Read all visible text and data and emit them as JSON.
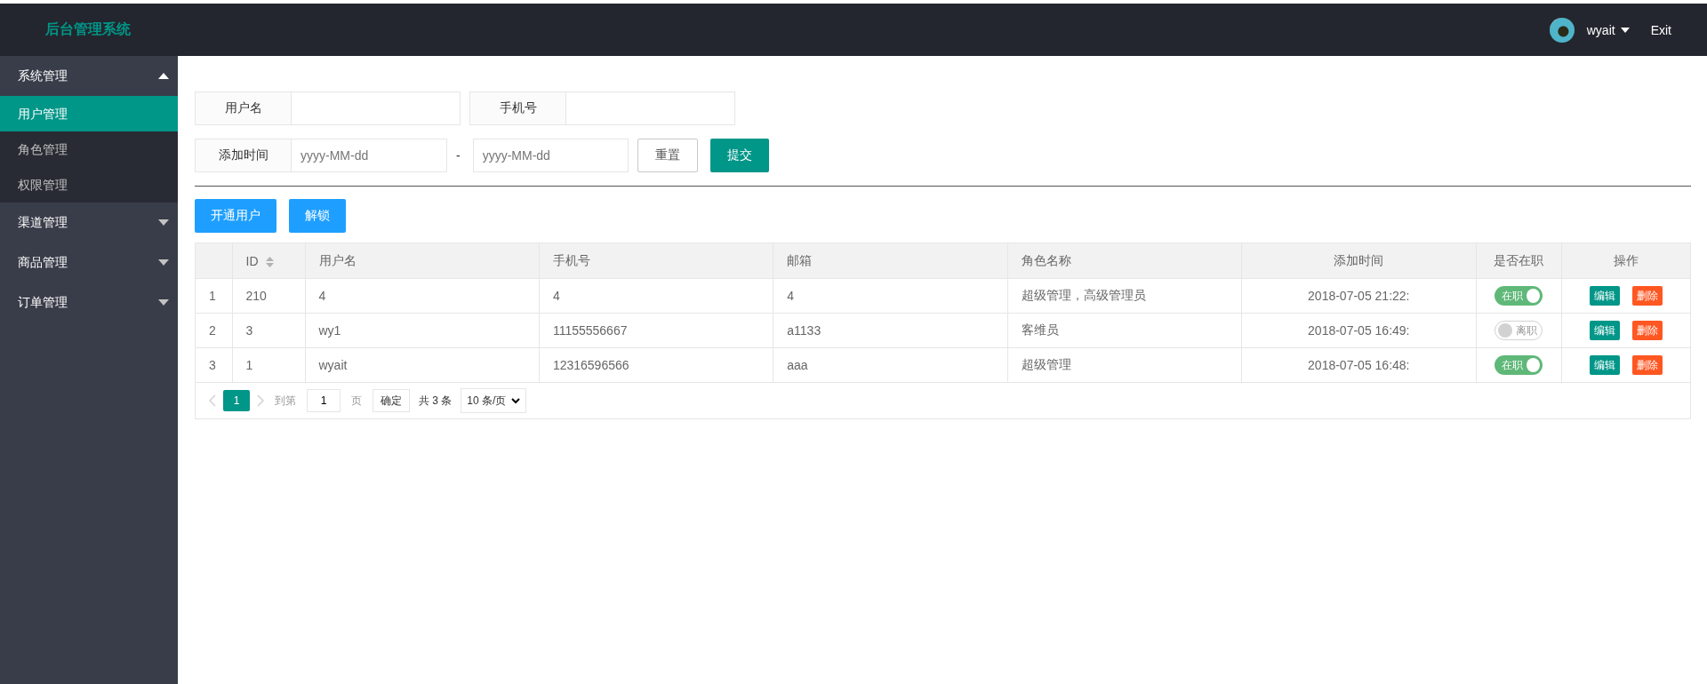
{
  "header": {
    "logo": "后台管理系统",
    "user": "wyait",
    "exit": "Exit"
  },
  "sidebar": {
    "groups": [
      {
        "label": "系统管理",
        "expanded": true,
        "children": [
          {
            "label": "用户管理",
            "selected": true
          },
          {
            "label": "角色管理",
            "selected": false
          },
          {
            "label": "权限管理",
            "selected": false
          }
        ]
      },
      {
        "label": "渠道管理",
        "expanded": false
      },
      {
        "label": "商品管理",
        "expanded": false
      },
      {
        "label": "订单管理",
        "expanded": false
      }
    ]
  },
  "search": {
    "rows": [
      {
        "fields": [
          {
            "label": "用户名"
          },
          {
            "label": "手机号"
          }
        ]
      },
      {
        "fields": [
          {
            "label": "添加时间",
            "placeholder": "yyyy-MM-dd"
          },
          {
            "separator": "-",
            "placeholder": "yyyy-MM-dd"
          }
        ],
        "buttons": [
          {
            "label": "重置",
            "kind": "plain"
          },
          {
            "label": "提交",
            "kind": "primary"
          }
        ]
      }
    ]
  },
  "toolbar": {
    "buttons": [
      "开通用户",
      "解锁"
    ]
  },
  "table": {
    "columns": [
      {},
      {
        "label": "ID",
        "sortable": true
      },
      {
        "label": "用户名"
      },
      {
        "label": "手机号"
      },
      {
        "label": "邮箱"
      },
      {
        "label": "角色名称"
      },
      {
        "label": "添加时间"
      },
      {
        "label": "是否在职"
      },
      {
        "label": "操作"
      }
    ],
    "rows": [
      {
        "index": "1",
        "id": "210",
        "username": "4",
        "phone": "4",
        "email": "4",
        "roles": "超级管理，高级管理员",
        "added": "2018-07-05 21:22:",
        "on": true,
        "switch_text": "在职",
        "actions": [
          "编辑",
          "删除"
        ]
      },
      {
        "index": "2",
        "id": "3",
        "username": "wy1",
        "phone": "11155556667",
        "email": "a1133",
        "roles": "客维员",
        "added": "2018-07-05 16:49:",
        "on": false,
        "switch_text": "离职",
        "actions": [
          "编辑",
          "删除"
        ]
      },
      {
        "index": "3",
        "id": "1",
        "username": "wyait",
        "phone": "12316596566",
        "email": "aaa",
        "roles": "超级管理",
        "added": "2018-07-05 16:48:",
        "on": true,
        "switch_text": "在职",
        "actions": [
          "编辑",
          "删除"
        ]
      }
    ]
  },
  "pagination": {
    "pages": [
      {
        "label": "1",
        "selected": true
      }
    ],
    "goto_label": "到第",
    "goto_value": "1",
    "page_unit": "页",
    "confirm": "确定",
    "total": "共 3 条",
    "page_size": "10 条/页"
  }
}
